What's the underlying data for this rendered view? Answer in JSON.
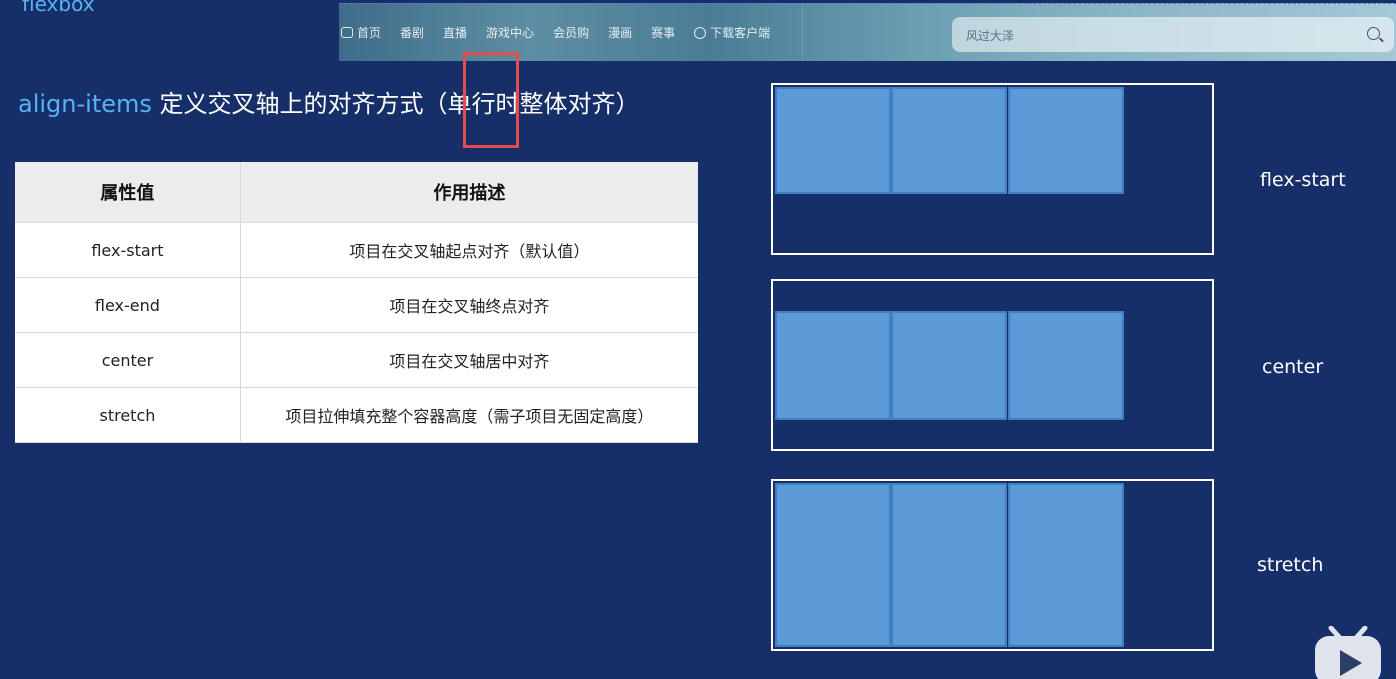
{
  "slide": {
    "top_label": "flexbox"
  },
  "navbar": {
    "items": [
      {
        "label": "首页",
        "icon": "tv-home-icon"
      },
      {
        "label": "番剧"
      },
      {
        "label": "直播"
      },
      {
        "label": "游戏中心"
      },
      {
        "label": "会员购"
      },
      {
        "label": "漫画"
      },
      {
        "label": "赛事"
      },
      {
        "label": "下载客户端",
        "icon": "download-icon"
      }
    ],
    "search": {
      "placeholder": "风过大泽"
    }
  },
  "heading": {
    "keyword": "align-items",
    "text": " 定义交叉轴上的对齐方式（单行时整体对齐）"
  },
  "table": {
    "headers": [
      "属性值",
      "作用描述"
    ],
    "rows": [
      {
        "value": "flex-start",
        "desc": "项目在交叉轴起点对齐（默认值）"
      },
      {
        "value": "flex-end",
        "desc": "项目在交叉轴终点对齐"
      },
      {
        "value": "center",
        "desc": "项目在交叉轴居中对齐"
      },
      {
        "value": "stretch",
        "desc": "项目拉伸填充整个容器高度（需子项目无固定高度）"
      }
    ]
  },
  "demos": [
    {
      "label": "flex-start"
    },
    {
      "label": "center"
    },
    {
      "label": "stretch"
    }
  ],
  "colors": {
    "background": "#172f68",
    "accent": "#56b3f2",
    "item_fill": "#5b9ad6",
    "highlight": "#e74c4c"
  }
}
